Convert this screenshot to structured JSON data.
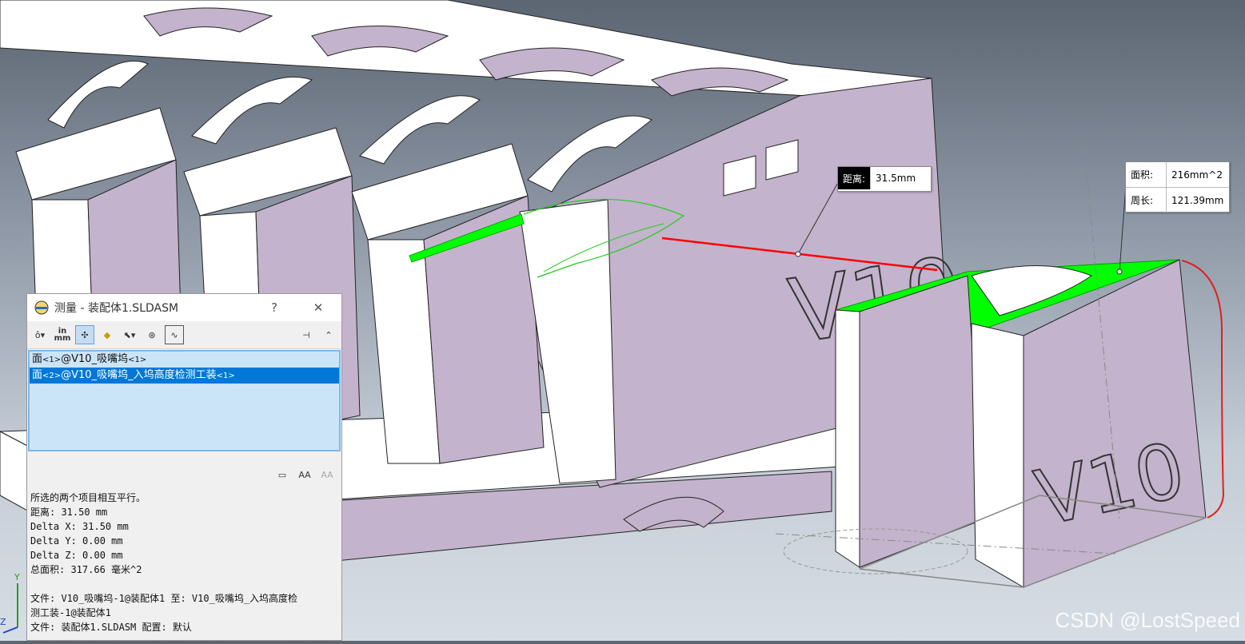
{
  "viewport": {
    "distance_callout": {
      "label": "距离:",
      "value": "31.5mm"
    },
    "area_callout": {
      "area_label": "面积:",
      "area_value": "216mm^2",
      "perimeter_label": "周长:",
      "perimeter_value": "121.39mm"
    },
    "engraving": "V10",
    "axis_labels": {
      "y": "Y",
      "z": "Z"
    },
    "colors": {
      "part": "#c4b3cc",
      "highlight": "#00ff00",
      "measure_line": "#ff0000",
      "annotation": "#e02020"
    }
  },
  "measure_dialog": {
    "title": "测量 - 装配体1.SLDASM",
    "help": "?",
    "close": "✕",
    "toolbar": {
      "units_top": "in",
      "units_bottom": "mm",
      "icons": [
        "arc-circle-icon",
        "units-icon",
        "show-xyz-icon",
        "point-to-point-icon",
        "projection-icon",
        "measure-history-icon",
        "sensor-icon"
      ]
    },
    "selections": [
      {
        "text": "面",
        "tag": "<1>",
        "path": "@V10_吸嘴坞",
        "tag2": "<1>"
      },
      {
        "text": "面",
        "tag": "<2>",
        "path": "@V10_吸嘴坞_入坞高度检测工装",
        "tag2": "<1>"
      }
    ],
    "results": {
      "parallel": "所选的两个项目相互平行。",
      "distance": "距离: 31.50 mm",
      "dx": "Delta X: 31.50 mm",
      "dy": "Delta Y: 0.00 mm",
      "dz": "Delta Z: 0.00 mm",
      "total_area": "总面积: 317.66 毫米^2",
      "file_line1": "文件:  V10_吸嘴坞-1@装配体1 至:  V10_吸嘴坞_入坞高度检",
      "file_line2": "测工装-1@装配体1",
      "file_line3": "文件:  装配体1.SLDASM 配置:  默认"
    }
  },
  "watermark": "CSDN @LostSpeed"
}
